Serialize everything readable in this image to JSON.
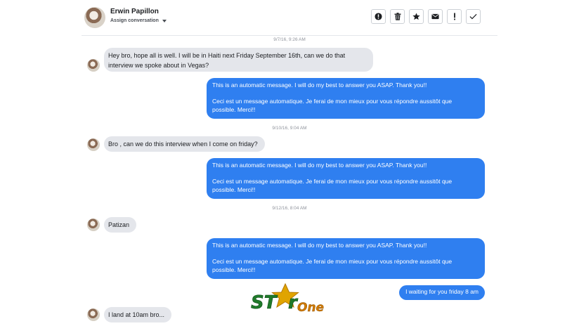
{
  "header": {
    "contact_name": "Erwin Papillon",
    "assign_label": "Assign conversation",
    "actions": [
      {
        "icon": "alert-circle-icon"
      },
      {
        "icon": "trash-icon"
      },
      {
        "icon": "star-icon"
      },
      {
        "icon": "envelope-icon"
      },
      {
        "icon": "exclamation-icon"
      },
      {
        "icon": "check-icon"
      }
    ]
  },
  "thread": {
    "timestamps": [
      "9/7/16, 9:26 AM",
      "9/10/16, 9:04 AM",
      "9/12/16, 8:04 AM"
    ],
    "incoming": [
      {
        "line1": "Hey bro, hope all is well. I will be in Haiti next Friday September 16th, can we do that",
        "line2": "interview we spoke about in Vegas?"
      },
      {
        "text": "Bro , can we do this interview when I come on friday?"
      },
      {
        "text": "Patizan"
      },
      {
        "text": "I land at 10am bro..."
      }
    ],
    "auto_reply": {
      "english": "This is an automatic message. I will do my best to answer you ASAP. Thank you!!",
      "french_line1": "Ceci est un message automatique. Je ferai de mon mieux pour vous répondre aussitôt que",
      "french_line2": "possible. Merci!!"
    },
    "outgoing_last": "I waiting for you friday 8 am"
  },
  "watermark": {
    "brand_st": "ST",
    "brand_r": "r",
    "brand_one": "One",
    "colors": {
      "green": "#1f7a2a",
      "gold": "#e0a400",
      "orange": "#d07a00"
    }
  },
  "colors": {
    "outgoing_bubble": "#2f7ff0",
    "incoming_bubble": "#e4e6eb"
  }
}
